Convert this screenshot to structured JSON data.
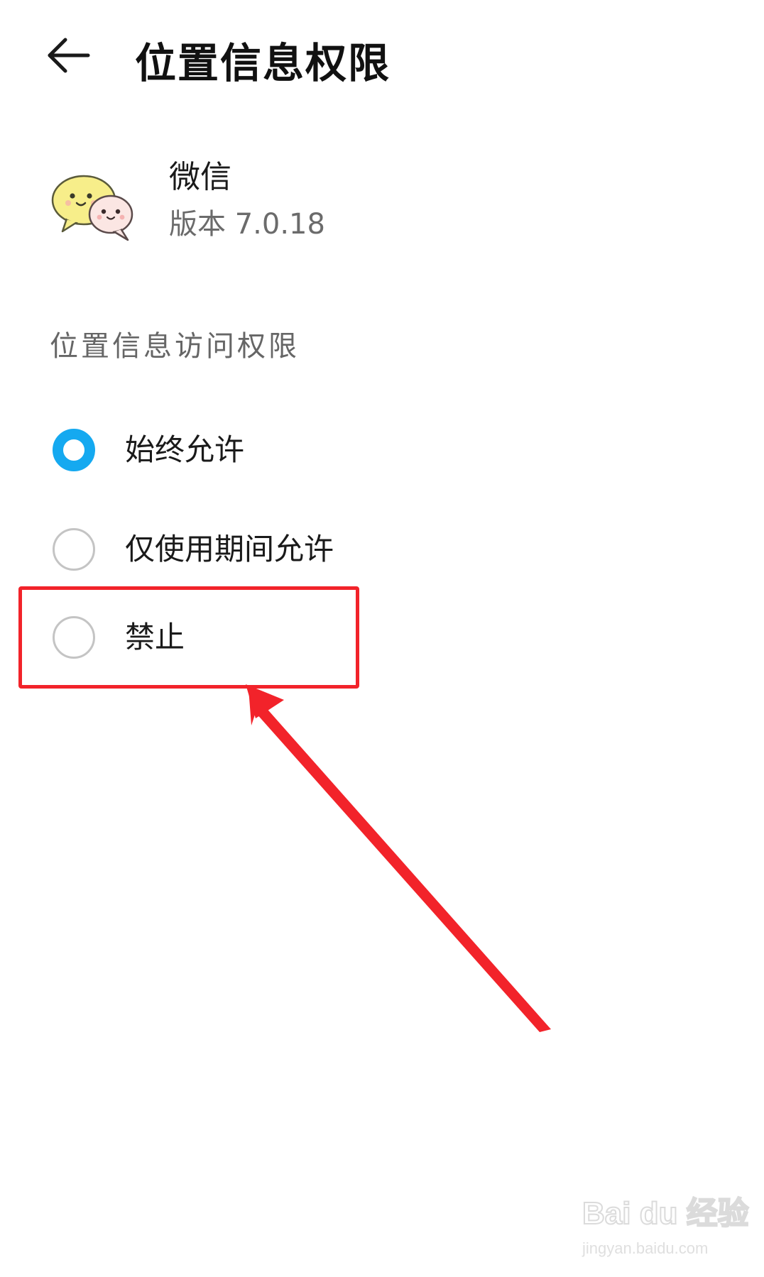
{
  "header": {
    "back_icon": "arrow-left-icon",
    "title": "位置信息权限"
  },
  "app": {
    "icon": "wechat-app-icon",
    "name": "微信",
    "version": "版本 7.0.18"
  },
  "section": {
    "title": "位置信息访问权限"
  },
  "options": [
    {
      "label": "始终允许",
      "selected": true
    },
    {
      "label": "仅使用期间允许",
      "selected": false
    },
    {
      "label": "禁止",
      "selected": false
    }
  ],
  "annotation": {
    "highlight_color": "#f2232a",
    "highlighted_option": "禁止"
  },
  "watermark": {
    "brand": "Bai du 经验",
    "url": "jingyan.baidu.com"
  },
  "colors": {
    "accent": "#15a9f0",
    "annotation_red": "#f2232a"
  }
}
